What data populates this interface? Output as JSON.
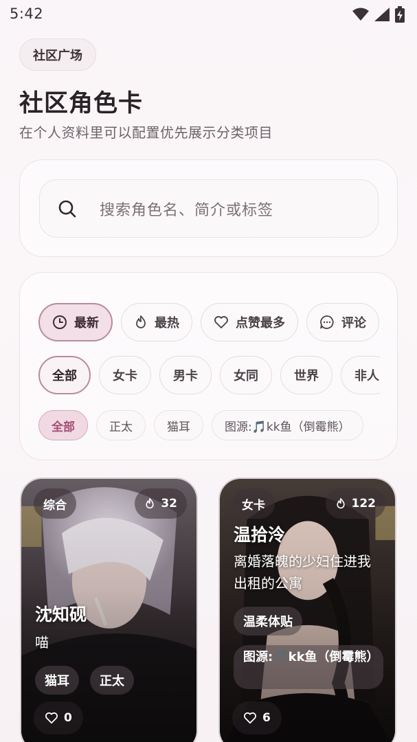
{
  "status": {
    "time": "5:42"
  },
  "header": {
    "chip": "社区广场",
    "title": "社区角色卡",
    "subtitle": "在个人资料里可以配置优先展示分类项目"
  },
  "search": {
    "placeholder": "搜索角色名、简介或标签"
  },
  "sort_tabs": [
    {
      "label": "最新",
      "icon": "clock-icon",
      "active": true
    },
    {
      "label": "最热",
      "icon": "flame-icon",
      "active": false
    },
    {
      "label": "点赞最多",
      "icon": "heart-icon",
      "active": false
    },
    {
      "label": "评论",
      "icon": "comment-icon",
      "active": false
    }
  ],
  "categories": [
    {
      "label": "全部",
      "active": true
    },
    {
      "label": "女卡",
      "active": false
    },
    {
      "label": "男卡",
      "active": false
    },
    {
      "label": "女同",
      "active": false
    },
    {
      "label": "世界",
      "active": false
    },
    {
      "label": "非人",
      "active": false
    }
  ],
  "tags": [
    {
      "label": "全部",
      "active": true
    },
    {
      "label": "正太",
      "active": false
    },
    {
      "label": "猫耳",
      "active": false
    },
    {
      "label": "图源:🎵kk鱼（倒霉熊）",
      "active": false
    }
  ],
  "cards": [
    {
      "type": "综合",
      "hot": "32",
      "name": "沈知砚",
      "desc": "喵",
      "tags": [
        "猫耳",
        "正太"
      ],
      "likes": "0"
    },
    {
      "type": "女卡",
      "hot": "122",
      "name": "温拾泠",
      "desc": "离婚落魄的少妇住进我出租的公寓",
      "tags": [
        "温柔体贴",
        "图源:🎵kk鱼（倒霉熊）"
      ],
      "likes": "6"
    }
  ],
  "colors": {
    "accent": "#b88a9c",
    "tag_active": "#a44f75"
  }
}
